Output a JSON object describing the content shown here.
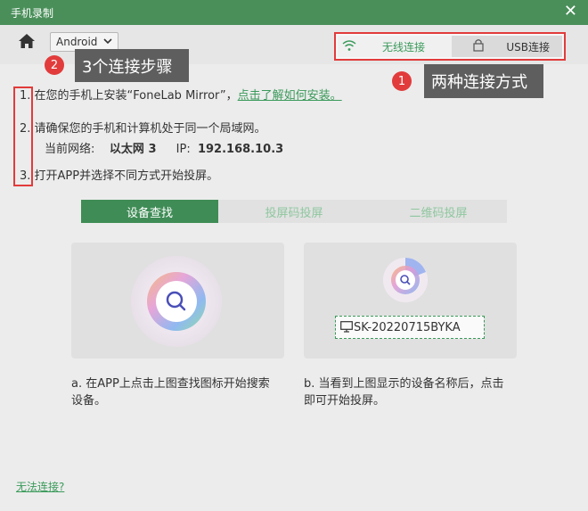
{
  "window": {
    "title": "手机录制"
  },
  "toolbar": {
    "os_selected": "Android",
    "wireless_label": "无线连接",
    "usb_label": "USB连接"
  },
  "annotations": {
    "badge1": "1",
    "callout1": "两种连接方式",
    "badge2": "2",
    "callout2": "3个连接步骤"
  },
  "steps": {
    "s1_prefix": "1. 在您的手机上安装“FoneLab Mirror”，",
    "s1_link": "点击了解如何安装。",
    "s2": "2. 请确保您的手机和计算机处于同一个局域网。",
    "net_label": "当前网络:",
    "net_value": "以太网 3",
    "ip_label": "IP:",
    "ip_value": "192.168.10.3",
    "s3": "3. 打开APP并选择不同方式开始投屏。"
  },
  "methods": {
    "tab1": "设备查找",
    "tab2": "投屏码投屏",
    "tab3": "二维码投屏"
  },
  "cards": {
    "device_name": "SK-20220715BYKA",
    "desc_a_line1": "a. 在APP上点击上图查找图标开始搜索",
    "desc_a_line2": "设备。",
    "desc_b_line1": "b. 当看到上图显示的设备名称后，点击",
    "desc_b_line2": "即可开始投屏。"
  },
  "footer": {
    "cant_connect": "无法连接?"
  },
  "colors": {
    "accent_green": "#3f8c56",
    "annotation_red": "#e23b3b"
  }
}
